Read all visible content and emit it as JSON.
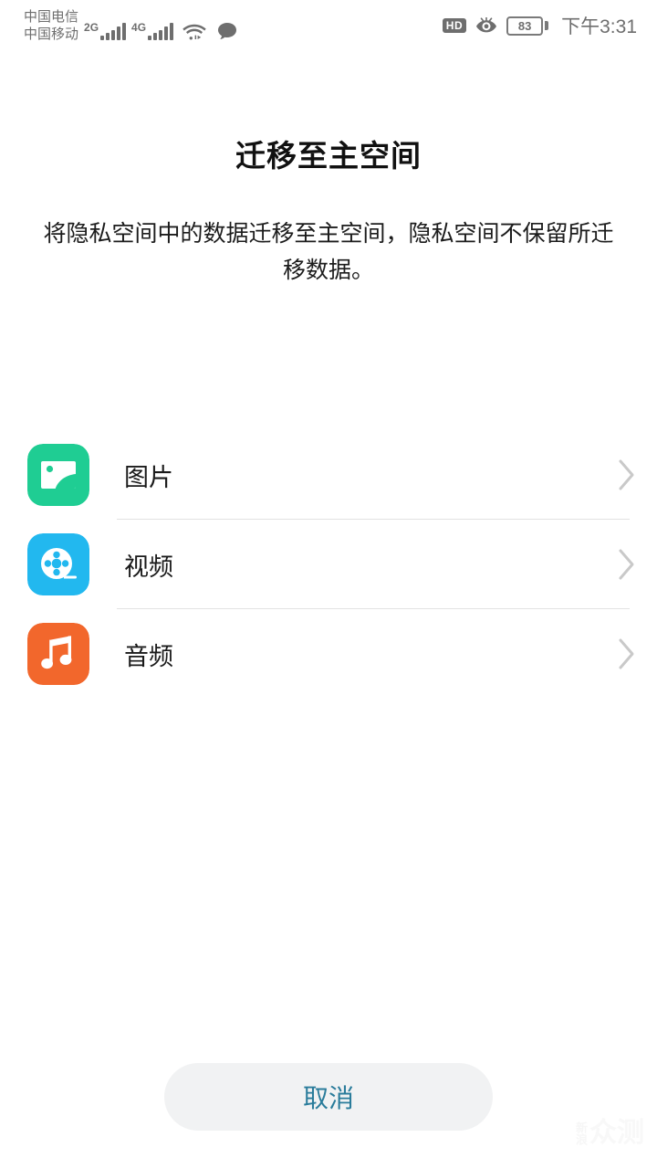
{
  "statusbar": {
    "carrier_primary": "中国电信",
    "carrier_secondary": "中国移动",
    "network_1": "2G",
    "network_2": "4G",
    "wifi_icon": "wifi-icon",
    "message_icon": "message-bubble-icon",
    "hd_badge": "HD",
    "eye_icon": "eye-comfort-icon",
    "battery_level": "83",
    "time": "下午3:31"
  },
  "page": {
    "title": "迁移至主空间",
    "description": "将隐私空间中的数据迁移至主空间，隐私空间不保留所迁移数据。"
  },
  "list": {
    "items": [
      {
        "label": "图片",
        "icon": "image-icon",
        "color": "#1fcd93",
        "chevron": "chevron-right-icon"
      },
      {
        "label": "视频",
        "icon": "video-icon",
        "color": "#22b8ef",
        "chevron": "chevron-right-icon"
      },
      {
        "label": "音频",
        "icon": "audio-icon",
        "color": "#f2672c",
        "chevron": "chevron-right-icon"
      }
    ]
  },
  "footer": {
    "cancel_label": "取消",
    "cancel_text_color": "#2a7c9b",
    "cancel_bg_color": "#f1f2f3"
  },
  "watermark": {
    "small": "新浪",
    "big": "众测"
  }
}
